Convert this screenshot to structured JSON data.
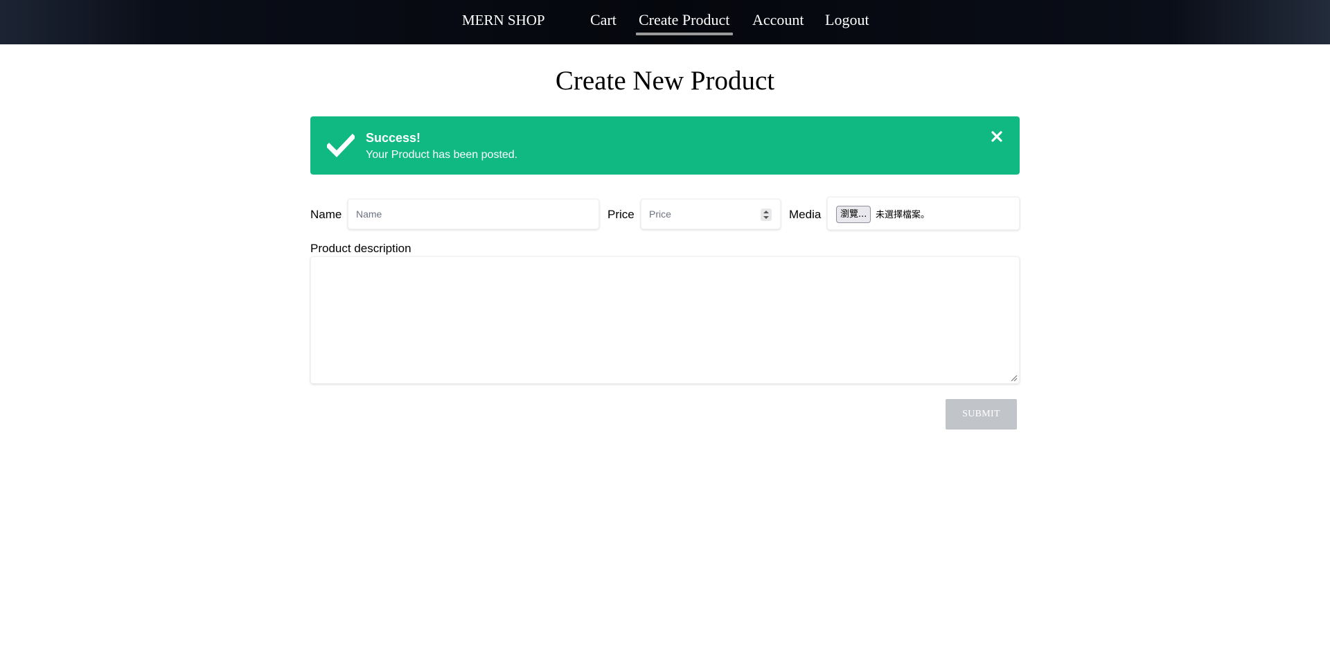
{
  "nav": {
    "brand": "MERN SHOP",
    "links": [
      {
        "label": "Cart",
        "active": false
      },
      {
        "label": "Create Product",
        "active": true
      },
      {
        "label": "Account",
        "active": false
      },
      {
        "label": "Logout",
        "active": false
      }
    ]
  },
  "page": {
    "title": "Create New Product"
  },
  "alert": {
    "type": "success",
    "title": "Success!",
    "message": "Your Product has been posted.",
    "color": "#10b981",
    "icon": "check-icon",
    "close_icon": "close-icon"
  },
  "form": {
    "name": {
      "label": "Name",
      "placeholder": "Name",
      "value": ""
    },
    "price": {
      "label": "Price",
      "placeholder": "Price",
      "value": ""
    },
    "media": {
      "label": "Media",
      "button_label": "瀏覽...",
      "status": "未選擇檔案。"
    },
    "description": {
      "label": "Product description",
      "value": ""
    },
    "submit_label": "SUBMIT",
    "submit_color": "#c1c4c9"
  }
}
